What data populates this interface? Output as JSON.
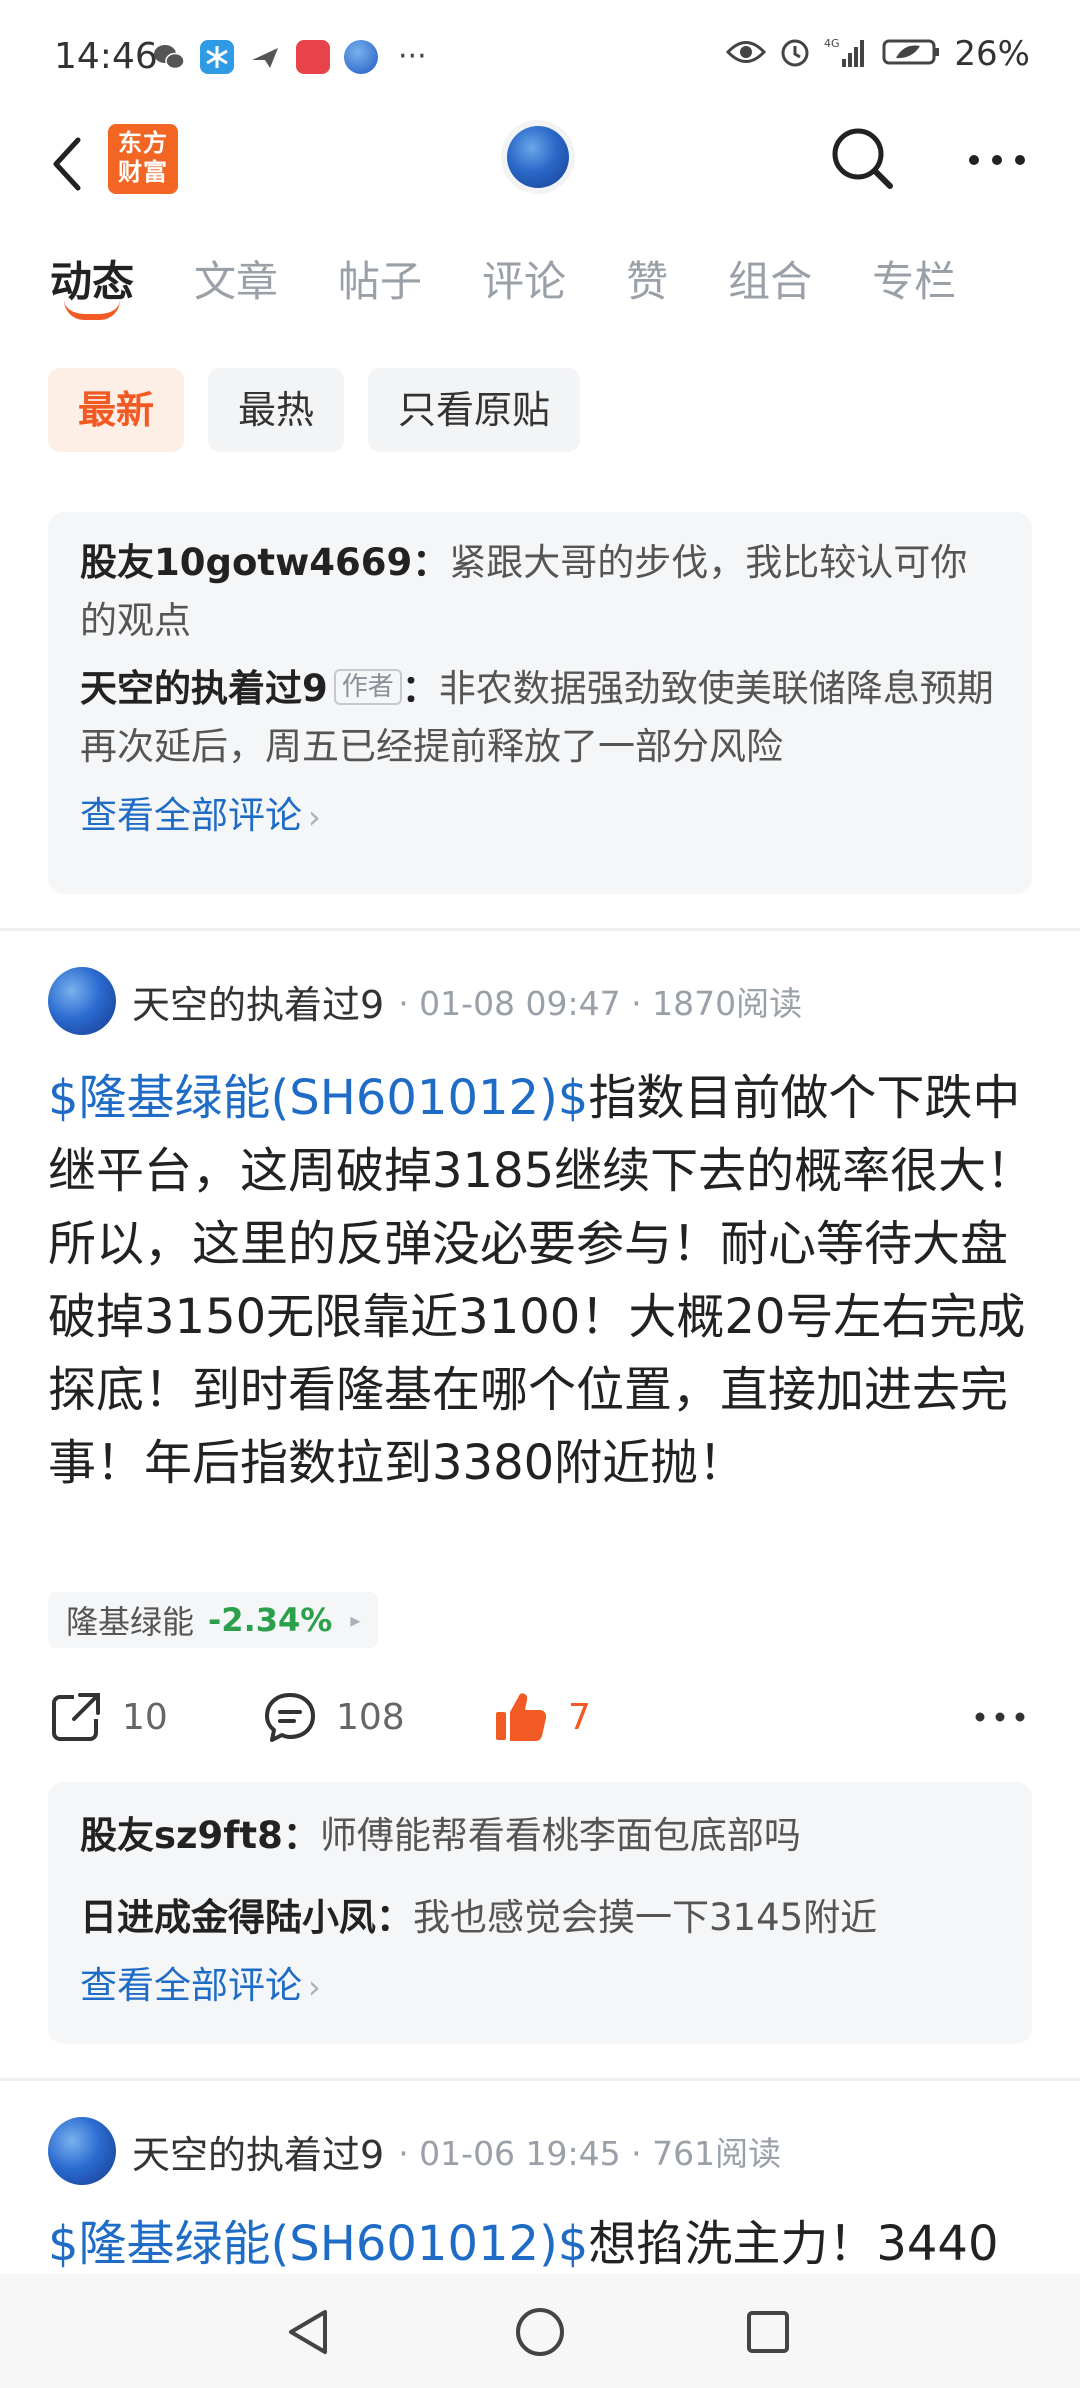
{
  "status_bar": {
    "time": "14:46",
    "more": "···",
    "battery": "26%"
  },
  "app_bar": {
    "logo_text_line1": "东方",
    "logo_text_line2": "财富"
  },
  "tabs": [
    {
      "label": "动态",
      "active": true
    },
    {
      "label": "文章"
    },
    {
      "label": "帖子"
    },
    {
      "label": "评论"
    },
    {
      "label": "赞"
    },
    {
      "label": "组合"
    },
    {
      "label": "专栏"
    }
  ],
  "filters": [
    {
      "label": "最新",
      "active": true
    },
    {
      "label": "最热"
    },
    {
      "label": "只看原贴"
    }
  ],
  "comment_box_1": {
    "comments": [
      {
        "user": "股友10gotw4669",
        "sep": "：",
        "text": "紧跟大哥的步伐，我比较认可你的观点"
      },
      {
        "user": "天空的执着过9",
        "tag": "作者",
        "sep": "：",
        "text": "非农数据强劲致使美联储降息预期再次延后，周五已经提前释放了一部分风险"
      }
    ],
    "view_all": "查看全部评论",
    "arrow": "›"
  },
  "posts": [
    {
      "user": "天空的执着过9",
      "meta": "· 01-08 09:47 · 1870阅读",
      "stock_link": "$隆基绿能(SH601012)$",
      "text": "指数目前做个下跌中继平台，这周破掉3185继续下去的概率很大！所以，这里的反弹没必要参与！耐心等待大盘破掉3150无限靠近3100！大概20号左右完成探底！到时看隆基在哪个位置，直接加进去完事！年后指数拉到3380附近抛！",
      "stock_name": "隆基绿能",
      "stock_change": "-2.34%",
      "stock_arrow": "▸",
      "shares": "10",
      "comments_count": "108",
      "likes": "7",
      "comments": [
        {
          "user": "股友sz9ft8",
          "sep": "：",
          "text": "师傅能帮看看桃李面包底部吗"
        },
        {
          "user": "日进成金得陆小凤",
          "sep": "：",
          "text": "我也感觉会摸一下3145附近"
        }
      ],
      "view_all": "查看全部评论",
      "arrow": "›"
    },
    {
      "user": "天空的执着过9",
      "meta": "· 01-06 19:45 · 761阅读",
      "stock_link": "$隆基绿能(SH601012)$",
      "text": "想掐洗主力！3440"
    }
  ],
  "colors": {
    "accent": "#f15a22",
    "link": "#1f6cc6",
    "up_down_green": "#2aa04a"
  }
}
